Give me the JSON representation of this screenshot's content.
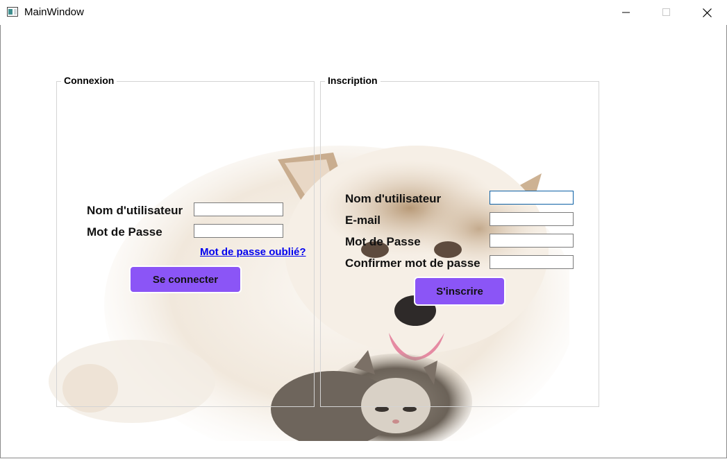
{
  "window": {
    "title": "MainWindow"
  },
  "login": {
    "title": "Connexion",
    "username_label": "Nom d'utilisateur",
    "password_label": "Mot de Passe",
    "username_value": "",
    "password_value": "",
    "forgot_link": "Mot de passe oublié?",
    "submit_label": "Se connecter"
  },
  "register": {
    "title": "Inscription",
    "username_label": "Nom d'utilisateur",
    "email_label": "E-mail",
    "password_label": "Mot de Passe",
    "confirm_label": "Confirmer mot de passe",
    "username_value": "",
    "email_value": "",
    "password_value": "",
    "confirm_value": "",
    "submit_label": "S'inscrire"
  },
  "colors": {
    "button": "#8b55f6",
    "link": "#0000ee",
    "focus_border": "#0b5fa5"
  },
  "icons": {
    "app": "window-icon",
    "minimize": "minimize-icon",
    "maximize": "maximize-icon",
    "close": "close-icon"
  }
}
